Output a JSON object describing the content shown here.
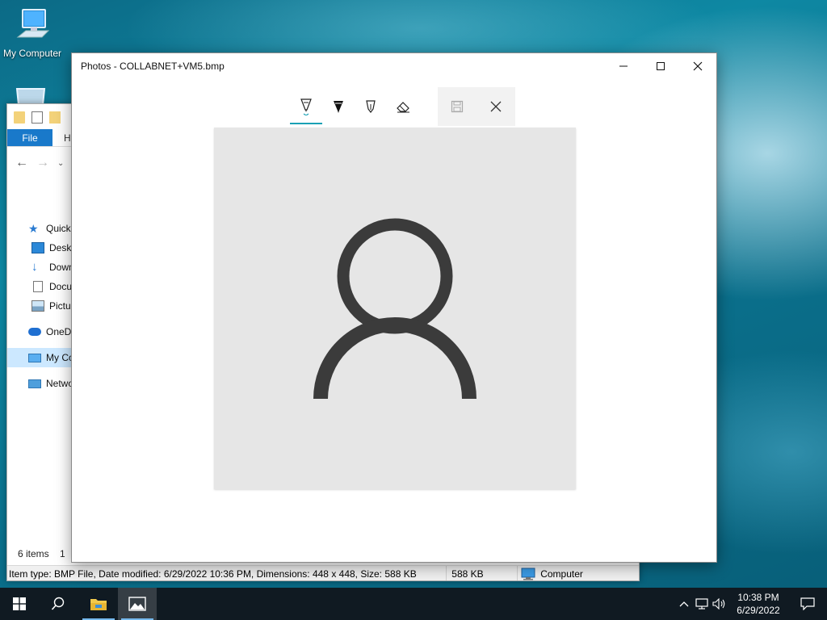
{
  "desktop": {
    "icons": [
      {
        "label": "My Computer"
      }
    ]
  },
  "explorer": {
    "ribbon": {
      "file_tab": "File",
      "home_tab": "H"
    },
    "nav_tree": [
      {
        "label": "Quick",
        "icon": "star-icon"
      },
      {
        "label": "Deskt",
        "icon": "desktop-icon"
      },
      {
        "label": "Down",
        "icon": "download-arrow-icon"
      },
      {
        "label": "Docu",
        "icon": "document-icon"
      },
      {
        "label": "Pictu",
        "icon": "pictures-icon"
      },
      {
        "label": "OneDr",
        "icon": "cloud-icon"
      },
      {
        "label": "My Co",
        "icon": "computer-icon"
      },
      {
        "label": "Netwo",
        "icon": "network-icon"
      }
    ],
    "item_count": "6 items",
    "item_count_suffix": "1",
    "statusbar": {
      "details": "Item type: BMP File, Date modified: 6/29/2022 10:36 PM, Dimensions: 448 x 448, Size: 588 KB",
      "size": "588 KB",
      "location": "Computer"
    }
  },
  "photos": {
    "title": "Photos - COLLABNET+VM5.bmp",
    "tools": [
      {
        "name": "ballpoint-pen",
        "icon": "ballpoint-pen-icon",
        "active": true
      },
      {
        "name": "pencil",
        "icon": "pencil-icon",
        "active": false
      },
      {
        "name": "calligraphy-pen",
        "icon": "calligraphy-pen-icon",
        "active": false
      },
      {
        "name": "eraser",
        "icon": "eraser-icon",
        "active": false
      }
    ],
    "actions": [
      "save-icon",
      "close-icon"
    ],
    "image": {
      "subject": "user-avatar-icon",
      "width": 448,
      "height": 448
    }
  },
  "taskbar": {
    "clock_time": "10:38 PM",
    "clock_date": "6/29/2022",
    "accent": "#76b9ed"
  }
}
